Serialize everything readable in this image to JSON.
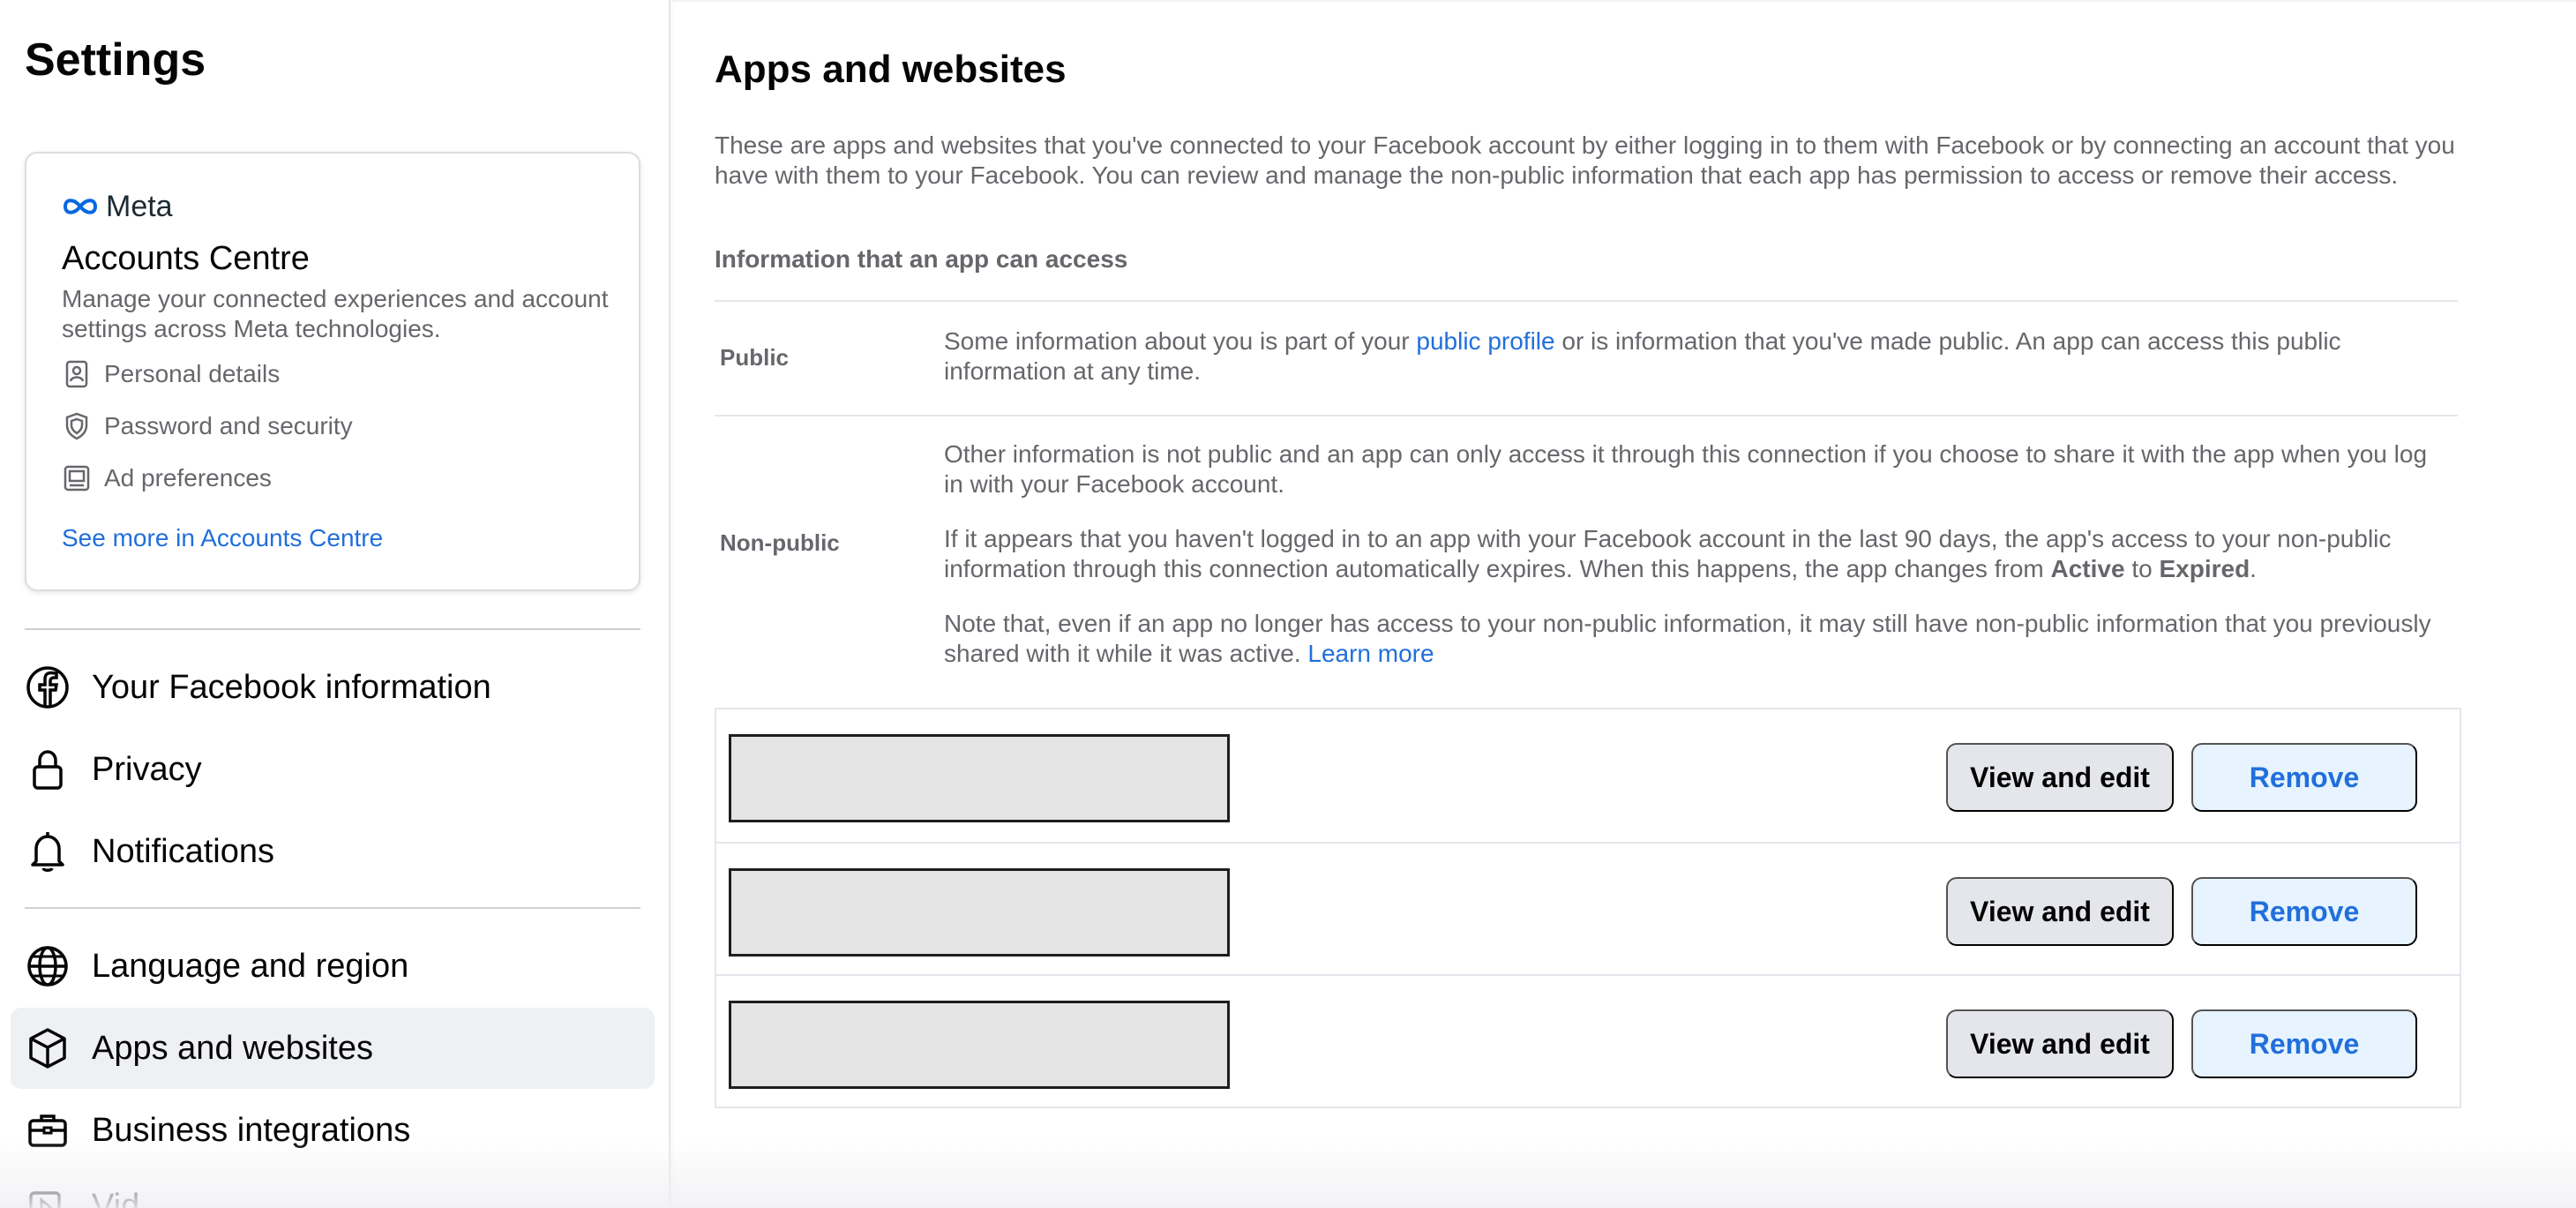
{
  "sidebar": {
    "title": "Settings",
    "accounts_centre": {
      "logo_text": "Meta",
      "title": "Accounts Centre",
      "description": "Manage your connected experiences and account settings across Meta technologies.",
      "items": [
        {
          "label": "Personal details",
          "icon": "id-card-icon"
        },
        {
          "label": "Password and security",
          "icon": "shield-icon"
        },
        {
          "label": "Ad preferences",
          "icon": "ad-preferences-icon"
        }
      ],
      "link": "See more in Accounts Centre"
    },
    "nav": [
      {
        "label": "Your Facebook information",
        "icon": "facebook-icon",
        "active": false
      },
      {
        "label": "Privacy",
        "icon": "lock-icon",
        "active": false
      },
      {
        "label": "Notifications",
        "icon": "bell-icon",
        "active": false
      },
      {
        "label": "Language and region",
        "icon": "globe-icon",
        "active": false
      },
      {
        "label": "Apps and websites",
        "icon": "cube-icon",
        "active": true
      },
      {
        "label": "Business integrations",
        "icon": "briefcase-icon",
        "active": false
      },
      {
        "label": "Vid",
        "icon": "video-icon",
        "active": false
      }
    ]
  },
  "main": {
    "title": "Apps and websites",
    "intro": "These are apps and websites that you've connected to your Facebook account by either logging in to them with Facebook or by connecting an account that you have with them to your Facebook. You can review and manage the non-public information that each app has permission to access or remove their access.",
    "info_heading": "Information that an app can access",
    "public": {
      "label": "Public",
      "text_before": "Some information about you is part of your ",
      "link": "public profile",
      "text_after": " or is information that you've made public. An app can access this public information at any time."
    },
    "non_public": {
      "label": "Non-public",
      "p1": "Other information is not public and an app can only access it through this connection if you choose to share it with the app when you log in with your Facebook account.",
      "p2_before": "If it appears that you haven't logged in to an app with your Facebook account in the last 90 days, the app's access to your non-public information through this connection automatically expires. When this happens, the app changes from ",
      "p2_active": "Active",
      "p2_mid": " to ",
      "p2_expired": "Expired",
      "p2_end": ".",
      "p3_before": "Note that, even if an app no longer has access to your non-public information, it may still have non-public information that you previously shared with it while it was active. ",
      "p3_link": "Learn more"
    },
    "apps": [
      {
        "view_label": "View and edit",
        "remove_label": "Remove"
      },
      {
        "view_label": "View and edit",
        "remove_label": "Remove"
      },
      {
        "view_label": "View and edit",
        "remove_label": "Remove"
      }
    ]
  },
  "colors": {
    "link": "#216fdb",
    "active_nav_bg": "#eef0f3",
    "remove_bg": "#e7f3ff",
    "view_bg": "#e4e6eb"
  }
}
